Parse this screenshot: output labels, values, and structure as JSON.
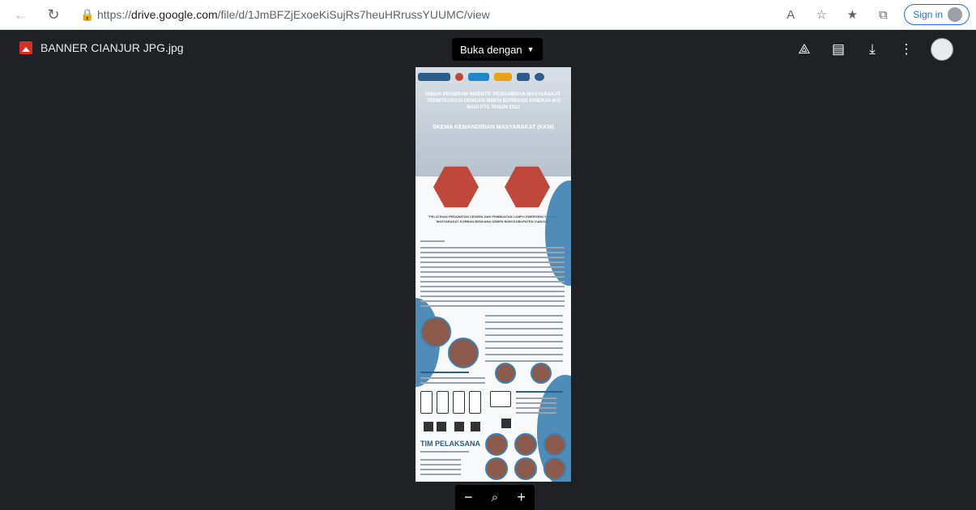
{
  "browser": {
    "url_prefix": "https://",
    "url_host": "drive.google.com",
    "url_path": "/file/d/1JmBFZjExoeKiSujRs7heuHRrussYUUMC/view",
    "signin_label": "Sign in"
  },
  "viewer": {
    "file_name": "BANNER CIANJUR JPG.jpg",
    "open_with_label": "Buka dengan",
    "toolbar_icons": [
      "add-to-drive-icon",
      "print-icon",
      "download-icon",
      "more-icon"
    ]
  },
  "poster": {
    "title": "HIBAH PROGRAM INSENTIF PENGABDIAN MASYARAKAT TERINTEGRASI DENGAN MBKM BERBASIS KINERJA IKU BAGI PTS TAHUN 2022",
    "scheme": "SKEMA KEMANDIRIAN MASYARAKAT (KKM)",
    "subtitle": "\"PELATIHAN PERAWATAN CEDERA DAN PEMBUATAN LAMPU EMERGENCY UNTUK MASYARAKAT KORBAN BENCANA GEMPA BUMI KABUPATEN CIANJUR\"",
    "team_label": "TIM PELAKSANA"
  },
  "zoom": {
    "minus": "−",
    "plus": "+"
  }
}
